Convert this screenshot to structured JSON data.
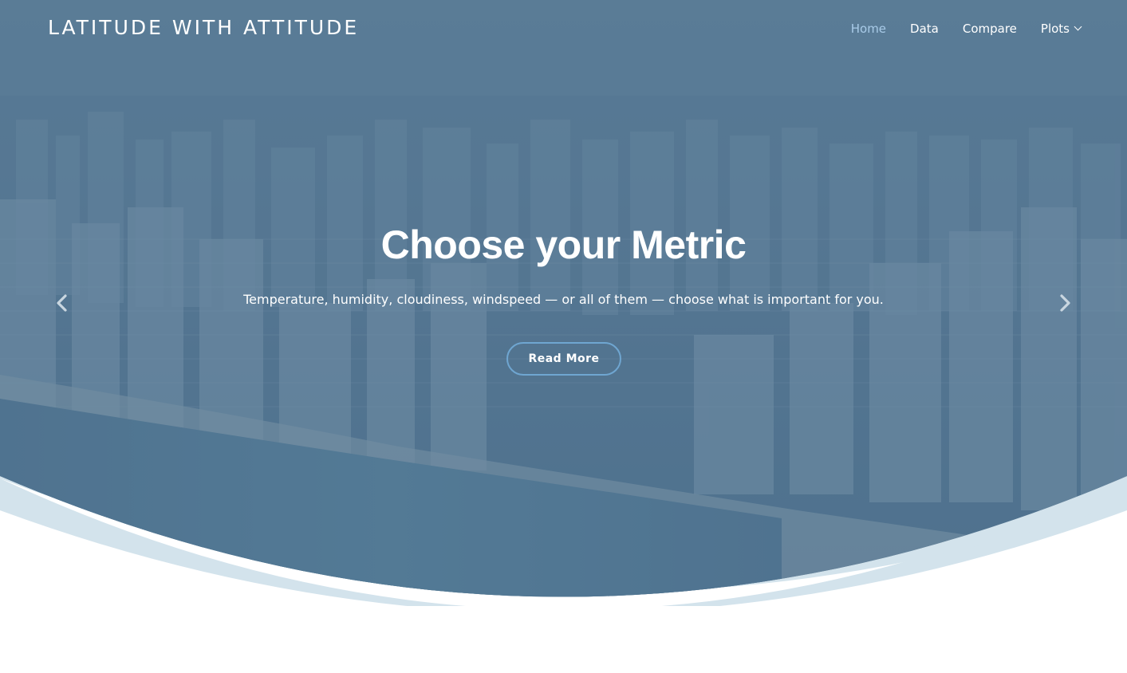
{
  "header": {
    "brand": "LATITUDE WITH ATTITUDE",
    "nav": [
      {
        "label": "Home",
        "active": true
      },
      {
        "label": "Data",
        "active": false
      },
      {
        "label": "Compare",
        "active": false
      },
      {
        "label": "Plots",
        "active": false,
        "dropdown": true
      }
    ]
  },
  "hero": {
    "title": "Choose your Metric",
    "text": "Temperature, humidity, cloudiness, windspeed — or all of them — choose what is important for you.",
    "button_label": "Read More",
    "prev_icon": "chevron-left-icon",
    "next_icon": "chevron-right-icon"
  },
  "colors": {
    "overlay": "#4f7391",
    "wave": "#d3e3ec",
    "nav_active": "#a9cbe8",
    "button_border": "#6fa6d1"
  }
}
